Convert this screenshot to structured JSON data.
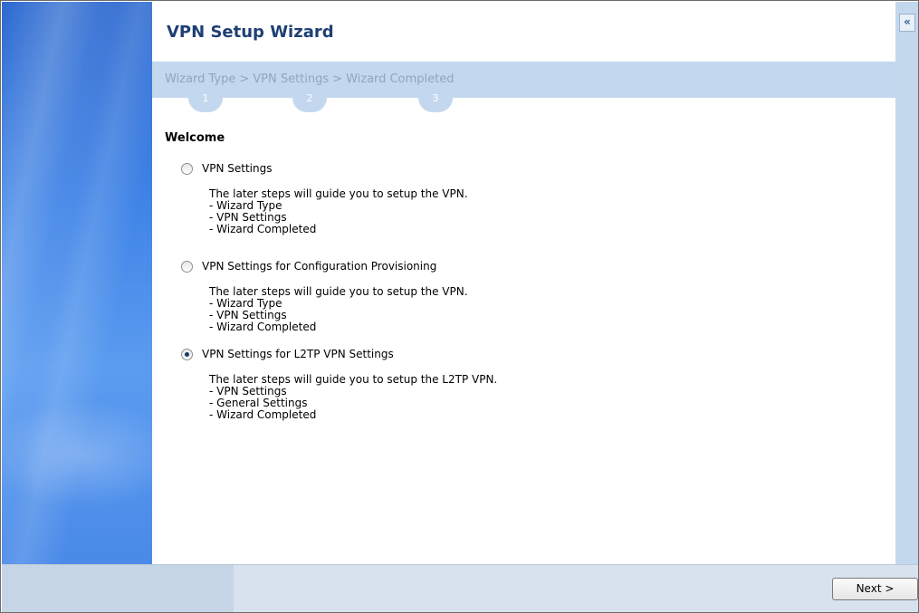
{
  "wizard": {
    "title": "VPN Setup Wizard"
  },
  "steps": [
    {
      "label": "Wizard Type",
      "number": "1"
    },
    {
      "label": "VPN Settings",
      "number": "2"
    },
    {
      "label": "Wizard Completed",
      "number": "3"
    }
  ],
  "step_separator": ">",
  "welcome_heading": "Welcome",
  "options": [
    {
      "label": "VPN Settings",
      "selected": false,
      "description": [
        "The later steps will guide you to setup the VPN.",
        "- Wizard Type",
        "- VPN Settings",
        "- Wizard Completed"
      ]
    },
    {
      "label": "VPN Settings for Configuration Provisioning",
      "selected": false,
      "description": [
        "The later steps will guide you to setup the VPN.",
        "- Wizard Type",
        "- VPN Settings",
        "- Wizard Completed"
      ]
    },
    {
      "label": "VPN Settings for L2TP VPN Settings",
      "selected": true,
      "description": [
        "The later steps will guide you to setup the L2TP VPN.",
        "- VPN Settings",
        "- General Settings",
        "- Wizard Completed"
      ]
    }
  ],
  "buttons": {
    "next": "Next >",
    "collapse": "«"
  },
  "icons": {
    "collapse": "double-chevron-left-icon"
  },
  "colors": {
    "title": "#1f3f74",
    "step_bar": "#c3d8ee",
    "side_panel": "#3f83e6"
  }
}
